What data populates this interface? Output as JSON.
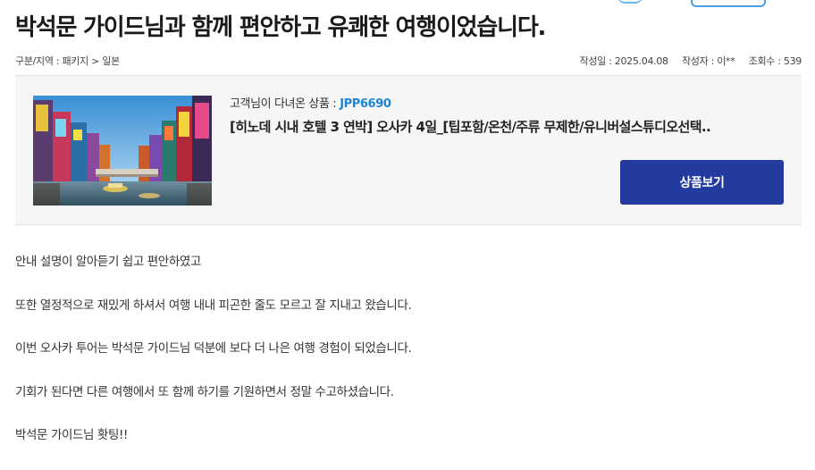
{
  "post": {
    "title": "박석문 가이드님과 함께 편안하고 유쾌한 여행이었습니다.",
    "category": "구분/지역 : 패키지 > 일본",
    "date": "작성일 : 2025.04.08",
    "author": "작성자 : 이**",
    "views": "조회수 : 539"
  },
  "product": {
    "label": "고객님이 다녀온 상품 :",
    "code": "JPP6690",
    "name": "[히노데 시내 호텔 3 연박] 오사카 4일_[팁포함/온천/주류 무제한/유니버설스튜디오선택..",
    "button_label": "상품보기",
    "image_icon": "osaka-dotonbori-photo"
  },
  "body": [
    "안내 설명이 알아듣기 쉽고 편안하였고",
    "또한 열정적으로 재밌게 하셔서 여행 내내 피곤한 줄도 모르고 잘 지내고 왔습니다.",
    "이번 오사카 투어는 박석문 가이드님 덕분에 보다 더 나은 여행 경험이 되었습니다.",
    "기회가 된다면 다른 여행에서 또 함께 하기를 기원하면서 정말 수고하셨습니다.",
    "박석문 가이드님 홧팅!!"
  ],
  "colors": {
    "accent_blue": "#1c86d6",
    "button_bg": "#233b9e",
    "box_bg": "#f6f6f6"
  }
}
